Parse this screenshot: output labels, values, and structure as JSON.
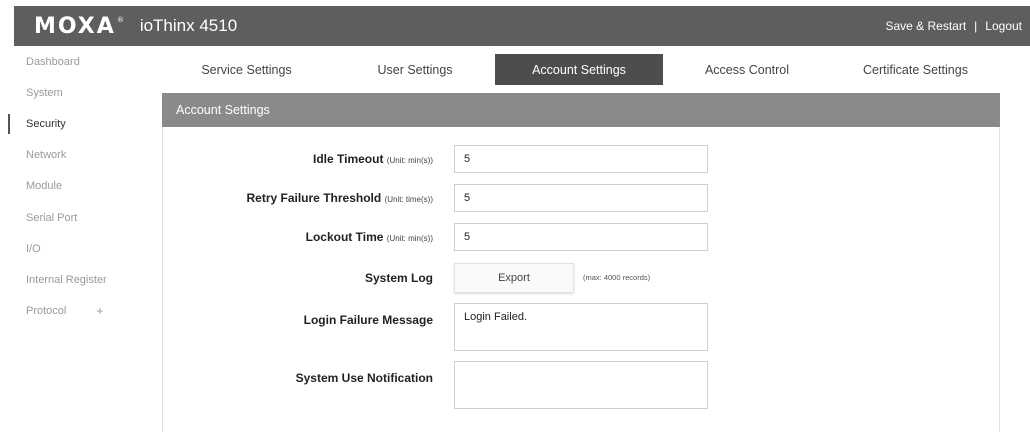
{
  "header": {
    "logo": "MOXA",
    "product": "ioThinx 4510",
    "save_restart": "Save & Restart",
    "separator": "|",
    "logout": "Logout"
  },
  "sidebar": {
    "items": [
      {
        "label": "Dashboard"
      },
      {
        "label": "System"
      },
      {
        "label": "Security",
        "active": true
      },
      {
        "label": "Network"
      },
      {
        "label": "Module"
      },
      {
        "label": "Serial Port"
      },
      {
        "label": "I/O"
      },
      {
        "label": "Internal Register"
      },
      {
        "label": "Protocol",
        "expand": "+"
      }
    ]
  },
  "tabs": [
    {
      "label": "Service Settings"
    },
    {
      "label": "User Settings"
    },
    {
      "label": "Account Settings",
      "active": true
    },
    {
      "label": "Access Control"
    },
    {
      "label": "Certificate Settings"
    }
  ],
  "panel": {
    "title": "Account Settings",
    "idle_timeout": {
      "label": "Idle Timeout",
      "unit": "(Unit: min(s))",
      "value": "5"
    },
    "retry_threshold": {
      "label": "Retry Failure Threshold",
      "unit": "(Unit: time(s))",
      "value": "5"
    },
    "lockout_time": {
      "label": "Lockout Time",
      "unit": "(Unit: min(s))",
      "value": "5"
    },
    "system_log": {
      "label": "System Log",
      "button": "Export",
      "note": "(max: 4000 records)"
    },
    "login_failure": {
      "label": "Login Failure Message",
      "value": "Login Failed."
    },
    "system_use": {
      "label": "System Use Notification",
      "value": ""
    }
  },
  "colors": {
    "topbar": "#5e5e5e",
    "active_tab": "#4d4d4d",
    "panel_header": "#8a8a8a"
  }
}
